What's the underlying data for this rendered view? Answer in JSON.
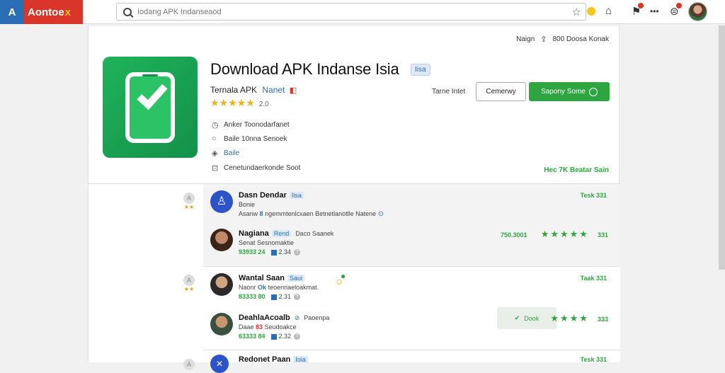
{
  "browser": {
    "brand_letter": "A",
    "brand_name": "Aontoe",
    "brand_mark": "x",
    "search_placeholder": "Iodang APK Indanseaod"
  },
  "header": {
    "meta_text": "Naign",
    "meta_count": "800 Doosa Konak"
  },
  "app": {
    "title": "Download APK Indanse Isia",
    "tag": "Iisa",
    "developer": "Ternala APK",
    "developer_link": "Nanet",
    "rating_stars": "★★★★★",
    "rating_value": "2.0",
    "info": [
      {
        "icon": "clock-icon",
        "text": "Anker  Toonodarfanet"
      },
      {
        "icon": "globe-icon",
        "text": "Baile  10nna Senoek"
      },
      {
        "icon": "tag-icon",
        "text": "Baile"
      },
      {
        "icon": "lock-icon",
        "text": "Cenetundaerkonde Soot"
      }
    ],
    "size_label": "Tarne Intet",
    "secondary_button": "Cemerwy",
    "primary_button": "Sapony Some",
    "more_link": "Hec  7K  Beatar Sain"
  },
  "reviews": {
    "groups": [
      {
        "side_icon": "A",
        "side_stars": "★★",
        "items": [
          {
            "avatar": "blue",
            "avatar_glyph": "♙",
            "name": "Dasn Dendar",
            "badge": "Iisa",
            "line1": "Bonie",
            "line2_prefix": "Asanw",
            "line2_bold": "8",
            "line2_rest": "ngemmtenlcxaen  Betnetlanotlle Natene",
            "date": "Tesk 331"
          },
          {
            "avatar": "brown",
            "name": "Nagiana",
            "badge": "Rend",
            "extra": "Daco  Saanek",
            "line1": "Senat Sesnomaktie",
            "line2_green": "93933 24",
            "line2_num": "2.34",
            "helpful": "750.3001",
            "stars": "★★★★★",
            "score": "331"
          }
        ]
      },
      {
        "side_icon": "A",
        "side_stars": "★★",
        "items": [
          {
            "avatar": "dark",
            "name": "Wantal Saan",
            "badge": "Saui",
            "line1_prefix": "Naonr",
            "line1_bold": "Ok",
            "line1_rest": "teoenriaeloakmat.",
            "line2_green": "83333 80",
            "line2_num": "2.31",
            "date": "Taak 331"
          },
          {
            "avatar": "green",
            "name": "DeahlaAcoalb",
            "badge": "Paoenpa",
            "line1_prefix": "Daae",
            "line1_bold": "83",
            "line1_rest": "Seudoakce",
            "line2_green": "63333 84",
            "line2_num": "2.32",
            "pill": "Dook",
            "stars": "★★★★",
            "score": "333"
          }
        ]
      },
      {
        "side_icon": "A",
        "items": [
          {
            "avatar": "blue",
            "avatar_glyph": "✕",
            "name": "Redonet Paan",
            "badge": "Ioia",
            "date": "Tesk 331"
          }
        ]
      }
    ]
  },
  "colors": {
    "accent_green": "#2ea53f",
    "link_blue": "#2a6fb5",
    "brand_red": "#d9352a",
    "star_gold": "#f0b017"
  }
}
